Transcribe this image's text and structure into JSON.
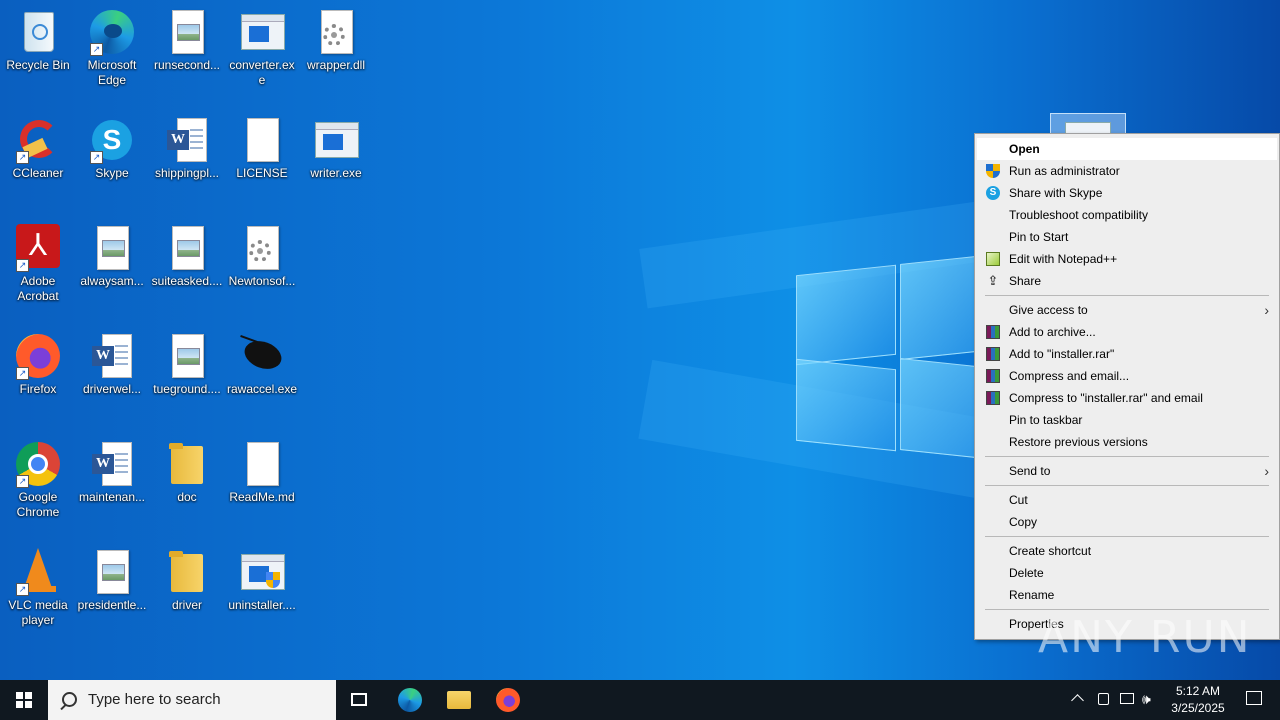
{
  "desktop_icons": [
    {
      "label": "Recycle Bin",
      "name": "recycle-bin-icon"
    },
    {
      "label": "Microsoft Edge",
      "name": "edge-icon"
    },
    {
      "label": "runsecond...",
      "name": "image-file-icon"
    },
    {
      "label": "converter.exe",
      "name": "exe-icon"
    },
    {
      "label": "wrapper.dll",
      "name": "dll-icon"
    },
    {
      "label": "CCleaner",
      "name": "ccleaner-icon"
    },
    {
      "label": "Skype",
      "name": "skype-icon"
    },
    {
      "label": "shippingpl...",
      "name": "word-doc-icon"
    },
    {
      "label": "LICENSE",
      "name": "blank-file-icon"
    },
    {
      "label": "writer.exe",
      "name": "exe-icon"
    },
    {
      "label": "Adobe Acrobat",
      "name": "acrobat-icon"
    },
    {
      "label": "alwaysam...",
      "name": "image-file-icon"
    },
    {
      "label": "suiteasked....",
      "name": "image-file-icon"
    },
    {
      "label": "Newtonsof...",
      "name": "dll-icon"
    },
    {
      "label": "Firefox",
      "name": "firefox-icon"
    },
    {
      "label": "driverwel...",
      "name": "word-doc-icon"
    },
    {
      "label": "tueground....",
      "name": "image-file-icon"
    },
    {
      "label": "rawaccel.exe",
      "name": "mouse-app-icon"
    },
    {
      "label": "Google Chrome",
      "name": "chrome-icon"
    },
    {
      "label": "maintenan...",
      "name": "word-doc-icon"
    },
    {
      "label": "doc",
      "name": "folder-icon"
    },
    {
      "label": "ReadMe.md",
      "name": "blank-file-icon"
    },
    {
      "label": "VLC media player",
      "name": "vlc-icon"
    },
    {
      "label": "presidentle...",
      "name": "image-file-icon"
    },
    {
      "label": "driver",
      "name": "folder-icon"
    },
    {
      "label": "uninstaller....",
      "name": "installer-icon"
    }
  ],
  "context_menu": {
    "items": [
      {
        "label": "Open"
      },
      {
        "label": "Run as administrator",
        "icon": "shield-icon"
      },
      {
        "label": "Share with Skype",
        "icon": "skype-icon"
      },
      {
        "label": "Troubleshoot compatibility"
      },
      {
        "label": "Pin to Start"
      },
      {
        "label": "Edit with Notepad++",
        "icon": "notepad-plus-icon"
      },
      {
        "label": "Share",
        "icon": "share-icon"
      },
      {
        "label": "Give access to"
      },
      {
        "label": "Add to archive...",
        "icon": "winrar-icon"
      },
      {
        "label": "Add to \"installer.rar\"",
        "icon": "winrar-icon"
      },
      {
        "label": "Compress and email...",
        "icon": "winrar-icon"
      },
      {
        "label": "Compress to \"installer.rar\" and email",
        "icon": "winrar-icon"
      },
      {
        "label": "Pin to taskbar"
      },
      {
        "label": "Restore previous versions"
      },
      {
        "label": "Send to"
      },
      {
        "label": "Cut"
      },
      {
        "label": "Copy"
      },
      {
        "label": "Create shortcut"
      },
      {
        "label": "Delete"
      },
      {
        "label": "Rename"
      },
      {
        "label": "Properties"
      }
    ]
  },
  "taskbar": {
    "search_placeholder": "Type here to search",
    "clock_time": "5:12 AM",
    "clock_date": "3/25/2025"
  },
  "watermark": "ANY RUN",
  "colors": {
    "taskbar": "#101820",
    "menu_bg": "#eeeeee",
    "accent": "#1a6fd6"
  }
}
